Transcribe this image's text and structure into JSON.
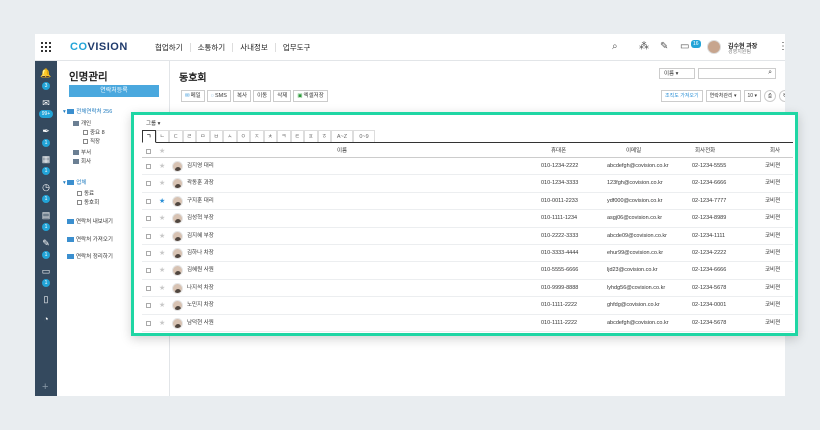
{
  "header": {
    "logo": "COVISION",
    "nav": [
      "협업하기",
      "소통하기",
      "사내정보",
      "업무도구"
    ],
    "icons": [
      "search-icon",
      "org-chart-icon",
      "pencil-icon",
      "calendar-icon"
    ],
    "calendar_badge": "16",
    "user_name": "김수현 과장",
    "user_dept": "경영지원팀"
  },
  "left_rail": {
    "badges": [
      "3",
      "99+",
      "1",
      "1",
      "1",
      "1",
      "1",
      "1"
    ]
  },
  "panel": {
    "title": "인명관리",
    "new_button": "연락처등록",
    "tree": {
      "all_contacts": "전체연락처 256",
      "personal": "개인",
      "important": "중요",
      "my_group": "직장",
      "dept": "부서",
      "company": "회사",
      "external": "업체",
      "family": "동료",
      "club": "동호회",
      "export": "연락처 내보내기",
      "import": "연락처 가져오기",
      "cleanup": "연락처 정리하기"
    },
    "important_count": "8"
  },
  "content": {
    "title": "동호회",
    "sort_label": "이름",
    "toolbar": {
      "mail": "메일",
      "sms": "SMS",
      "copy": "복사",
      "move": "이동",
      "delete": "삭제",
      "excel": "엑셀저장"
    },
    "right_tools": {
      "org_import": "조직도 가져오기",
      "view_type": "연락처관리",
      "page_size": "10"
    }
  },
  "overlay": {
    "group_label": "그룹",
    "index_tabs": [
      "ㄱ",
      "ㄴ",
      "ㄷ",
      "ㄹ",
      "ㅁ",
      "ㅂ",
      "ㅅ",
      "ㅇ",
      "ㅈ",
      "ㅊ",
      "ㅋ",
      "ㅌ",
      "ㅍ",
      "ㅎ",
      "A~Z",
      "0~9"
    ],
    "columns": {
      "name": "이름",
      "mobile": "휴대폰",
      "email": "이메일",
      "phone": "회사전화",
      "company": "회사"
    },
    "rows": [
      {
        "name": "김지영 대리",
        "mobile": "010-1234-2222",
        "email": "abcdefgh@covision.co.kr",
        "phone": "02-1234-5555",
        "company": "코비젼",
        "starred": false
      },
      {
        "name": "곽동훈 과장",
        "mobile": "010-1234-3333",
        "email": "123fgh@covision.co.kr",
        "phone": "02-1234-6666",
        "company": "코비젼",
        "starred": false
      },
      {
        "name": "구지훈 대리",
        "mobile": "010-0011-2233",
        "email": "ydf000@covision.co.kr",
        "phone": "02-1234-7777",
        "company": "코비젼",
        "starred": true
      },
      {
        "name": "김성혁 부장",
        "mobile": "010-1111-1234",
        "email": "asgj06@covision.co.kr",
        "phone": "02-1234-8989",
        "company": "코비젼",
        "starred": false
      },
      {
        "name": "김지혜 부장",
        "mobile": "010-2222-3333",
        "email": "abcde09@covision.co.kr",
        "phone": "02-1234-1111",
        "company": "코비젼",
        "starred": false
      },
      {
        "name": "김하나 차장",
        "mobile": "010-3333-4444",
        "email": "ehur99@covision.co.kr",
        "phone": "02-1234-2222",
        "company": "코비젼",
        "starred": false
      },
      {
        "name": "김혜원 사원",
        "mobile": "010-5555-6666",
        "email": "ljd23@covision.co.kr",
        "phone": "02-1234-6666",
        "company": "코비젼",
        "starred": false
      },
      {
        "name": "나지석 차장",
        "mobile": "010-9999-8888",
        "email": "lyhdg56@covision.co.kr",
        "phone": "02-1234-5678",
        "company": "코비젼",
        "starred": false
      },
      {
        "name": "노민지 차장",
        "mobile": "010-1111-2222",
        "email": "ghfdg@covision.co.kr",
        "phone": "02-1234-0001",
        "company": "코비젼",
        "starred": false
      },
      {
        "name": "남덕현 사원",
        "mobile": "010-1111-2222",
        "email": "abcdefgh@covision.co.kr",
        "phone": "02-1234-5678",
        "company": "코비젼",
        "starred": false
      }
    ]
  },
  "colors": {
    "accent": "#22a4d8",
    "highlight": "#1fd6a4",
    "rail": "#34495e"
  }
}
